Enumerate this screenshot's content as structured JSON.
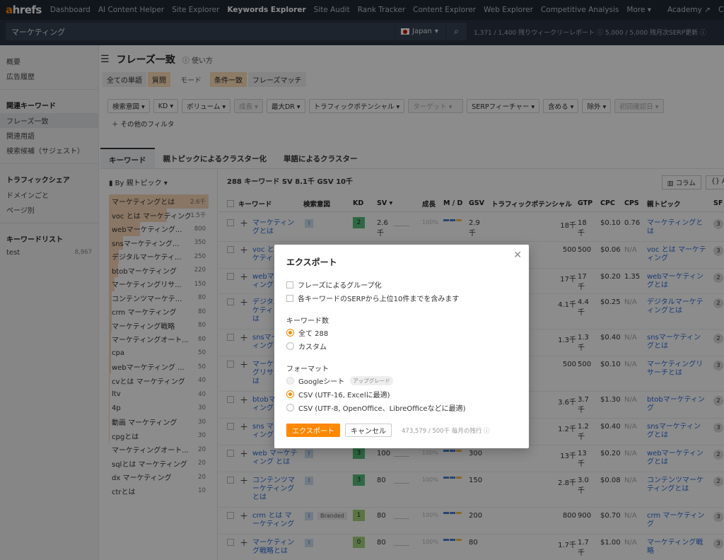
{
  "nav": {
    "logo_a": "a",
    "logo_rest": "hrefs",
    "items": [
      "Dashboard",
      "AI Content Helper",
      "Site Explorer",
      "Keywords Explorer",
      "Site Audit",
      "Rank Tracker",
      "Content Explorer",
      "Web Explorer",
      "Competitive Analysis",
      "More ▾"
    ],
    "active": "Keywords Explorer",
    "right_items": [
      "Academy ↗",
      "Community ↗"
    ]
  },
  "search": {
    "keyword": "マーケティング",
    "country": "Japan",
    "credits": "1,371 / 1,400 残りウィークリーレポート ⓘ   5,000 / 5,000 残月次SERP更新 ⓘ"
  },
  "sidebar": {
    "top_items": [
      "概要",
      "広告履歴"
    ],
    "related_head": "関連キーワード",
    "related_items": [
      "フレーズ一致",
      "関連用語",
      "検索候補（サジェスト）"
    ],
    "related_active": "フレーズ一致",
    "traffic_head": "トラフィックシェア",
    "traffic_items": [
      "ドメインごと",
      "ページ別"
    ],
    "list_head": "キーワードリスト",
    "list_name": "test",
    "list_count": "8,967"
  },
  "page": {
    "title": "フレーズ一致",
    "help": "ⓘ 使い方",
    "mode_chips": [
      "全ての単語",
      "質問"
    ],
    "mode_label": "モード",
    "match_chips": [
      "条件一致",
      "フレーズマッチ"
    ]
  },
  "filters": [
    "検索意図 ▾",
    "KD ▾",
    "ボリューム ▾",
    "成長 ▾",
    "最大DR ▾",
    "トラフィックポテンシャル ▾",
    "ターゲット ▾",
    "SERPフィーチャー ▾",
    "含める ▾",
    "除外 ▾",
    "初回確認日 ▾",
    "＋ その他のフィルタ"
  ],
  "tabs": [
    "キーワード",
    "親トピックによるクラスター化",
    "単語によるクラスター"
  ],
  "groups": {
    "selector": "▮ By 親トピック ▾",
    "items": [
      {
        "label": "マーケティングとは",
        "count": "2.6千",
        "fill": 1.0
      },
      {
        "label": "voc とは マーケティング",
        "count": "1.5千",
        "fill": 0.58
      },
      {
        "label": "webマーケティング...",
        "count": "800",
        "fill": 0.31
      },
      {
        "label": "snsマーケティング...",
        "count": "350",
        "fill": 0.14
      },
      {
        "label": "デジタルマーケティ...",
        "count": "250",
        "fill": 0.1
      },
      {
        "label": "btobマーケティング",
        "count": "220",
        "fill": 0.09
      },
      {
        "label": "マーケティングリサ...",
        "count": "150",
        "fill": 0.06
      },
      {
        "label": "コンテンツマーケテ...",
        "count": "80",
        "fill": 0.03
      },
      {
        "label": "crm マーケティング",
        "count": "80",
        "fill": 0.03
      },
      {
        "label": "マーケティング戦略",
        "count": "80",
        "fill": 0.03
      },
      {
        "label": "マーケティングオート...",
        "count": "60",
        "fill": 0.02
      },
      {
        "label": "cpa",
        "count": "50",
        "fill": 0.02
      },
      {
        "label": "webマーケティング ...",
        "count": "50",
        "fill": 0.02
      },
      {
        "label": "cvとは マーケティング",
        "count": "40",
        "fill": 0.01
      },
      {
        "label": "ltv",
        "count": "40",
        "fill": 0.01
      },
      {
        "label": "4p",
        "count": "30",
        "fill": 0.01
      },
      {
        "label": "動画 マーケティング",
        "count": "30",
        "fill": 0.01
      },
      {
        "label": "cpgとは",
        "count": "30",
        "fill": 0.01
      },
      {
        "label": "マーケティングオート...",
        "count": "20",
        "fill": 0.0
      },
      {
        "label": "sqlとは マーケティング",
        "count": "20",
        "fill": 0.0
      },
      {
        "label": "dx マーケティング",
        "count": "20",
        "fill": 0.0
      },
      {
        "label": "ctrとは",
        "count": "10",
        "fill": 0.0
      }
    ]
  },
  "table": {
    "summary": "288 キーワード   SV 8.1千   GSV 10千",
    "buttons": [
      "▥ コラム",
      "{} API"
    ],
    "columns": [
      "キーワード",
      "検索意図",
      "KD",
      "SV ▾",
      "成長",
      "M / D",
      "GSV",
      "トラフィックポテンシャル",
      "GTP",
      "CPC",
      "CPS",
      "親トピック",
      "SF"
    ],
    "rows": [
      {
        "kw": "マーケティングとは",
        "kd": "2",
        "sv": "2.6千",
        "gsv": "2.9千",
        "tp": "18千",
        "gtp": "18千",
        "cpc": "$0.10",
        "cps": "0.76",
        "parent": "マーケティングとは",
        "sf": "3"
      },
      {
        "kw": "voc とは マーケティング",
        "kd": "",
        "sv": "",
        "gsv": "",
        "tp": "500",
        "gtp": "500",
        "cpc": "$0.06",
        "cps": "N/A",
        "parent": "voc とは マーケティング",
        "sf": "3"
      },
      {
        "kw": "webマーケティング",
        "kd": "",
        "sv": "",
        "gsv": "",
        "tp": "17千",
        "gtp": "17千",
        "cpc": "$0.20",
        "cps": "1.35",
        "parent": "webマーケティングとは",
        "sf": "2"
      },
      {
        "kw": "デジタルマーケティングとは",
        "kd": "",
        "sv": "",
        "gsv": "",
        "tp": "4.1千",
        "gtp": "4.4千",
        "cpc": "$0.25",
        "cps": "N/A",
        "parent": "デジタルマーケティングとは",
        "sf": "2"
      },
      {
        "kw": "snsマーケティング",
        "kd": "",
        "sv": "",
        "gsv": "",
        "tp": "1.3千",
        "gtp": "1.3千",
        "cpc": "$0.40",
        "cps": "N/A",
        "parent": "snsマーケティングとは",
        "sf": "2"
      },
      {
        "kw": "マーケティングリサーチとは",
        "kd": "",
        "sv": "",
        "gsv": "",
        "tp": "500",
        "gtp": "500",
        "cpc": "$0.10",
        "cps": "N/A",
        "parent": "マーケティングリサーチとは",
        "sf": "3"
      },
      {
        "kw": "btobマーケティング",
        "kd": "",
        "sv": "",
        "gsv": "",
        "tp": "3.6千",
        "gtp": "3.7千",
        "cpc": "$1.30",
        "cps": "N/A",
        "parent": "btobマーケティング",
        "sf": "2"
      },
      {
        "kw": "sns マーケティング",
        "kd": "",
        "sv": "",
        "gsv": "",
        "tp": "1.2千",
        "gtp": "1.2千",
        "cpc": "$0.40",
        "cps": "N/A",
        "parent": "snsマーケティングとは",
        "sf": "3"
      },
      {
        "kw": "web マーケティング とは",
        "kd": "3",
        "sv": "100",
        "gsv": "300",
        "tp": "13千",
        "gtp": "13千",
        "cpc": "$0.20",
        "cps": "N/A",
        "parent": "webマーケティングとは",
        "sf": "2"
      },
      {
        "kw": "コンテンツマーケティングとは",
        "kd": "3",
        "sv": "80",
        "gsv": "150",
        "tp": "2.8千",
        "gtp": "3.0千",
        "cpc": "$0.08",
        "cps": "N/A",
        "parent": "コンテンツマーケティングとは",
        "sf": "2"
      },
      {
        "kw": "crm とは マーケティング",
        "kd": "1",
        "sv": "80",
        "gsv": "200",
        "tp": "800",
        "gtp": "900",
        "cpc": "$0.70",
        "cps": "N/A",
        "parent": "crm マーケティング",
        "sf": "3"
      },
      {
        "kw": "マーケティング戦略とは",
        "kd": "0",
        "sv": "80",
        "gsv": "80",
        "tp": "1.7千",
        "gtp": "1.7千",
        "cpc": "$1.00",
        "cps": "N/A",
        "parent": "マーケティング戦略",
        "sf": "3"
      }
    ],
    "intent_badge": "I",
    "branded": "Branded",
    "pct": "100%"
  },
  "modal": {
    "title": "エクスポート",
    "close": "✕",
    "check1": "フレーズによるグループ化",
    "check2": "各キーワードのSERPから上位10件までを含みます",
    "count_label": "キーワード数",
    "radio_all": "全て 288",
    "radio_custom": "カスタム",
    "format_label": "フォーマット",
    "fmt_google": "Googleシート",
    "upgrade": "アップグレード",
    "fmt_csv16": "CSV (UTF-16, Excelに最適)",
    "fmt_csv8": "CSV (UTF-8, OpenOffice、LibreOfficeなどに最適)",
    "export_btn": "エクスポート",
    "cancel_btn": "キャンセル",
    "quota": "473,579 / 500千 毎月の残行 ⓘ"
  },
  "colors": {
    "accent": "#ff8800",
    "nav_bg": "#202936",
    "link": "#2a6bd8"
  }
}
